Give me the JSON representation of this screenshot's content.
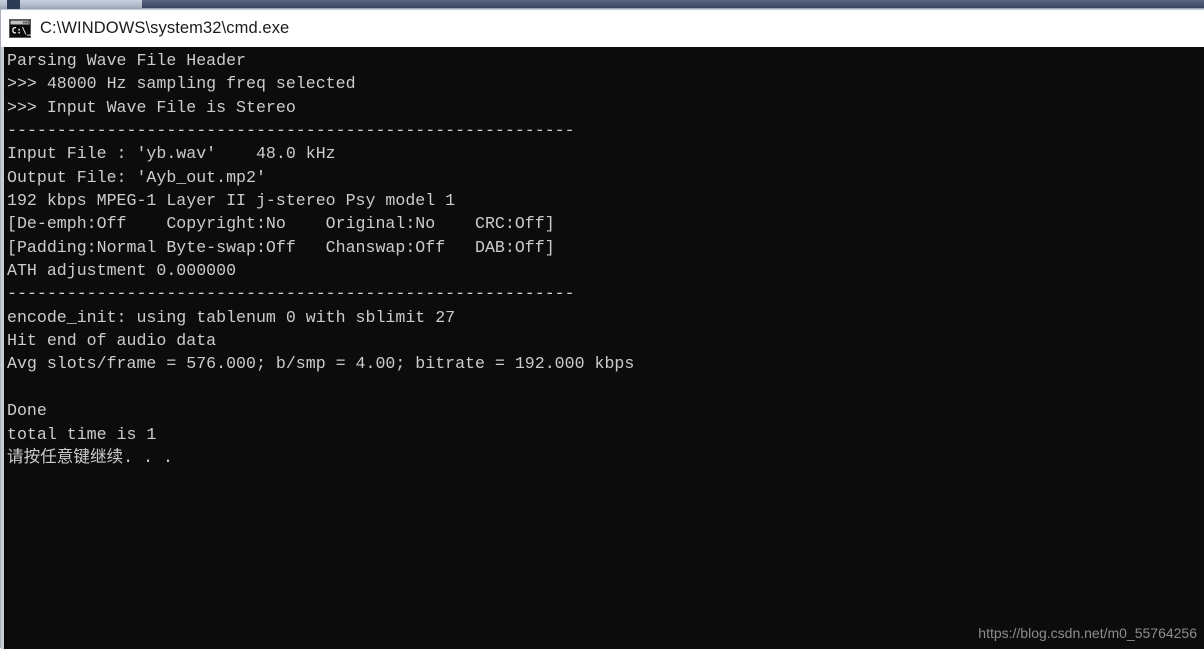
{
  "window": {
    "title": "C:\\WINDOWS\\system32\\cmd.exe",
    "icon": "cmd-console-icon",
    "titlebar_bg": "#ffffff",
    "titlebar_fg": "#1b1b1b",
    "console_bg": "#0c0c0c",
    "console_fg": "#cccccc"
  },
  "console": {
    "lines": [
      "Parsing Wave File Header",
      ">>> 48000 Hz sampling freq selected",
      ">>> Input Wave File is Stereo",
      "---------------------------------------------------------",
      "Input File : 'yb.wav'    48.0 kHz",
      "Output File: 'Ayb_out.mp2'",
      "192 kbps MPEG-1 Layer II j-stereo Psy model 1",
      "[De-emph:Off    Copyright:No    Original:No    CRC:Off]",
      "[Padding:Normal Byte-swap:Off   Chanswap:Off   DAB:Off]",
      "ATH adjustment 0.000000",
      "---------------------------------------------------------",
      "encode_init: using tablenum 0 with sblimit 27",
      "Hit end of audio data",
      "Avg slots/frame = 576.000; b/smp = 4.00; bitrate = 192.000 kbps",
      "",
      "Done",
      "total time is 1",
      "请按任意键继续. . ."
    ],
    "text": "Parsing Wave File Header\n>>> 48000 Hz sampling freq selected\n>>> Input Wave File is Stereo\n---------------------------------------------------------\nInput File : 'yb.wav'    48.0 kHz\nOutput File: 'Ayb_out.mp2'\n192 kbps MPEG-1 Layer II j-stereo Psy model 1\n[De-emph:Off    Copyright:No    Original:No    CRC:Off]\n[Padding:Normal Byte-swap:Off   Chanswap:Off   DAB:Off]\nATH adjustment 0.000000\n---------------------------------------------------------\nencode_init: using tablenum 0 with sblimit 27\nHit end of audio data\nAvg slots/frame = 576.000; b/smp = 4.00; bitrate = 192.000 kbps\n\nDone\ntotal time is 1\n请按任意键继续. . ."
  },
  "watermark": {
    "text": "https://blog.csdn.net/m0_55764256",
    "color": "#8d8d8d"
  }
}
